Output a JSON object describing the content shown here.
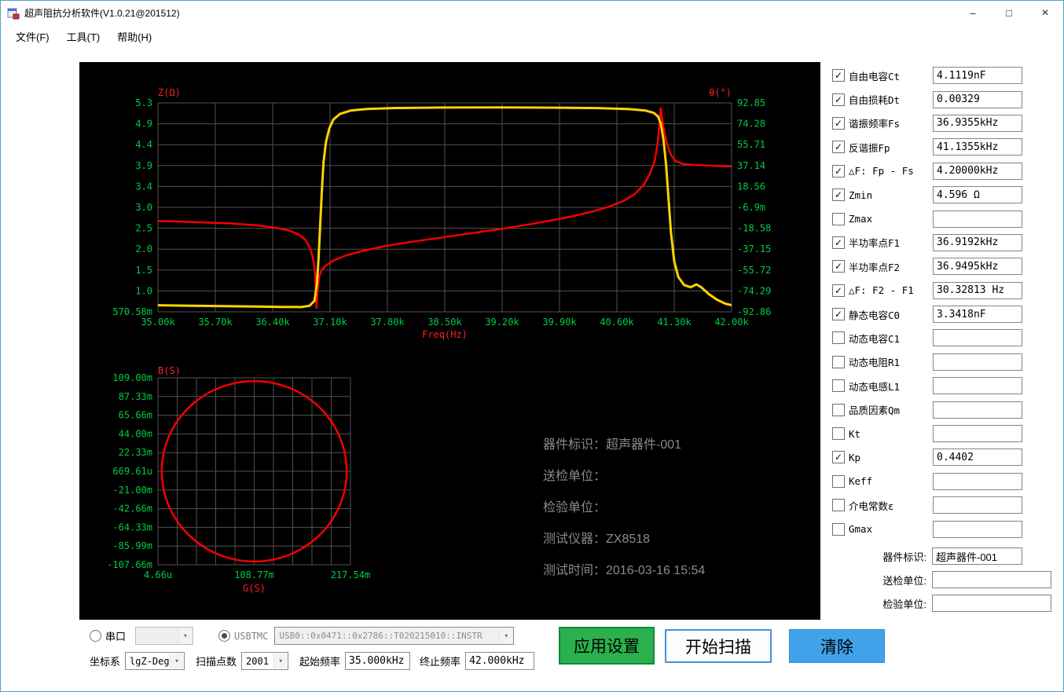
{
  "window": {
    "title": "超声阻抗分析软件(V1.0.21@201512)",
    "controls": {
      "minimize": "–",
      "maximize": "□",
      "close": "×"
    }
  },
  "menu": {
    "items": [
      "文件(F)",
      "工具(T)",
      "帮助(H)"
    ]
  },
  "colors": {
    "grid": "#525252",
    "tick": "#00cc44",
    "axis_label": "#ff2020",
    "curve_impedance": "#f40000",
    "curve_phase": "#ffd400",
    "apply_button": "#2ab04d",
    "clear_button": "#41a2ea"
  },
  "chart_data": [
    {
      "type": "line",
      "title_left": "Z(Ω)",
      "title_right": "θ(°)",
      "xlabel": "Freq(Hz)",
      "x_ticks": [
        "35.00k",
        "35.70k",
        "36.40k",
        "37.10k",
        "37.80k",
        "38.50k",
        "39.20k",
        "39.90k",
        "40.60k",
        "41.30k",
        "42.00k"
      ],
      "y_left_ticks": [
        "5.3",
        "4.9",
        "4.4",
        "3.9",
        "3.4",
        "3.0",
        "2.5",
        "2.0",
        "1.5",
        "1.0",
        "570.58m"
      ],
      "y_right_ticks": [
        "92.85",
        "74.28",
        "55.71",
        "37.14",
        "18.56",
        "-6.9m",
        "-18.58",
        "-37.15",
        "-55.72",
        "-74.29",
        "-92.86"
      ],
      "x_range": [
        35.0,
        42.0
      ],
      "y_left_range": [
        0.5706,
        5.3
      ],
      "y_right_range": [
        -92.86,
        92.85
      ],
      "grid": true,
      "series": [
        {
          "name": "impedance",
          "color": "#f40000",
          "axis": "left",
          "points": [
            [
              35.0,
              2.63
            ],
            [
              35.3,
              2.61
            ],
            [
              35.6,
              2.59
            ],
            [
              35.9,
              2.57
            ],
            [
              36.2,
              2.53
            ],
            [
              36.45,
              2.47
            ],
            [
              36.6,
              2.41
            ],
            [
              36.72,
              2.32
            ],
            [
              36.8,
              2.2
            ],
            [
              36.86,
              2.0
            ],
            [
              36.9,
              1.72
            ],
            [
              36.92,
              1.38
            ],
            [
              36.9355,
              0.66
            ],
            [
              36.95,
              1.1
            ],
            [
              36.97,
              1.38
            ],
            [
              37.0,
              1.52
            ],
            [
              37.05,
              1.62
            ],
            [
              37.15,
              1.74
            ],
            [
              37.3,
              1.85
            ],
            [
              37.5,
              1.95
            ],
            [
              37.75,
              2.05
            ],
            [
              38.0,
              2.13
            ],
            [
              38.3,
              2.21
            ],
            [
              38.6,
              2.29
            ],
            [
              38.9,
              2.37
            ],
            [
              39.2,
              2.45
            ],
            [
              39.5,
              2.54
            ],
            [
              39.8,
              2.64
            ],
            [
              40.05,
              2.73
            ],
            [
              40.3,
              2.84
            ],
            [
              40.5,
              2.95
            ],
            [
              40.68,
              3.08
            ],
            [
              40.82,
              3.24
            ],
            [
              40.93,
              3.45
            ],
            [
              41.0,
              3.68
            ],
            [
              41.06,
              3.98
            ],
            [
              41.1,
              4.4
            ],
            [
              41.1355,
              5.18
            ],
            [
              41.17,
              4.75
            ],
            [
              41.21,
              4.38
            ],
            [
              41.26,
              4.12
            ],
            [
              41.32,
              3.98
            ],
            [
              41.4,
              3.92
            ],
            [
              41.5,
              3.9
            ],
            [
              41.6,
              3.89
            ],
            [
              41.75,
              3.88
            ],
            [
              42.0,
              3.86
            ]
          ]
        },
        {
          "name": "phase",
          "color": "#ffd400",
          "axis": "right",
          "points": [
            [
              35.0,
              -87.0
            ],
            [
              35.4,
              -87.4
            ],
            [
              35.8,
              -87.8
            ],
            [
              36.2,
              -88.2
            ],
            [
              36.5,
              -88.5
            ],
            [
              36.75,
              -88.6
            ],
            [
              36.85,
              -87.5
            ],
            [
              36.91,
              -83
            ],
            [
              36.94,
              -68
            ],
            [
              36.96,
              -45
            ],
            [
              36.98,
              -15
            ],
            [
              37.0,
              15
            ],
            [
              37.02,
              40
            ],
            [
              37.05,
              58
            ],
            [
              37.09,
              70
            ],
            [
              37.14,
              78
            ],
            [
              37.22,
              83
            ],
            [
              37.35,
              86
            ],
            [
              37.55,
              87.5
            ],
            [
              37.9,
              88.3
            ],
            [
              38.5,
              88.7
            ],
            [
              39.2,
              88.8
            ],
            [
              39.9,
              88.6
            ],
            [
              40.4,
              88.2
            ],
            [
              40.75,
              87.3
            ],
            [
              40.95,
              86
            ],
            [
              41.05,
              84
            ],
            [
              41.1,
              81
            ],
            [
              41.1355,
              75
            ],
            [
              41.17,
              60
            ],
            [
              41.2,
              38
            ],
            [
              41.23,
              8
            ],
            [
              41.26,
              -22
            ],
            [
              41.3,
              -48
            ],
            [
              41.35,
              -62
            ],
            [
              41.42,
              -69
            ],
            [
              41.5,
              -71
            ],
            [
              41.57,
              -68.5
            ],
            [
              41.63,
              -71
            ],
            [
              41.72,
              -77
            ],
            [
              41.82,
              -82
            ],
            [
              41.92,
              -85.5
            ],
            [
              42.0,
              -87
            ]
          ]
        }
      ]
    },
    {
      "type": "line",
      "title": "B(S)",
      "xlabel": "G(S)",
      "x_ticks": [
        "4.66u",
        "108.77m",
        "217.54m"
      ],
      "y_ticks": [
        "109.00m",
        "87.33m",
        "65.66m",
        "44.00m",
        "22.33m",
        "669.61u",
        "-21.00m",
        "-42.66m",
        "-64.33m",
        "-85.99m",
        "-107.66m"
      ],
      "x_range": [
        4.66e-06,
        0.21754
      ],
      "y_range": [
        -0.10766,
        0.109
      ],
      "grid": true,
      "circle": {
        "cx": 0.10877,
        "cy": 0.00067,
        "r": 0.1045,
        "color": "#f40000"
      }
    }
  ],
  "info": {
    "lines": [
      "器件标识：超声器件-001",
      "送检单位：",
      "检验单位：",
      "测试仪器：ZX8518",
      "测试时间：2016-03-16 15:54"
    ]
  },
  "results": {
    "rows": [
      {
        "label": "自由电容Ct",
        "checked": true,
        "value": "4.1119nF"
      },
      {
        "label": "自由损耗Dt",
        "checked": true,
        "value": "0.00329"
      },
      {
        "label": "谐振频率Fs",
        "checked": true,
        "value": "36.9355kHz"
      },
      {
        "label": "反谐振Fp",
        "checked": true,
        "value": "41.1355kHz"
      },
      {
        "label": "△F: Fp - Fs",
        "checked": true,
        "value": "4.20000kHz"
      },
      {
        "label": "Zmin",
        "checked": true,
        "value": "4.596 Ω"
      },
      {
        "label": "Zmax",
        "checked": false,
        "value": ""
      },
      {
        "label": "半功率点F1",
        "checked": true,
        "value": "36.9192kHz"
      },
      {
        "label": "半功率点F2",
        "checked": true,
        "value": "36.9495kHz"
      },
      {
        "label": "△F: F2 - F1",
        "checked": true,
        "value": "30.32813 Hz"
      },
      {
        "label": "静态电容C0",
        "checked": true,
        "value": "3.3418nF"
      },
      {
        "label": "动态电容C1",
        "checked": false,
        "value": ""
      },
      {
        "label": "动态电阻R1",
        "checked": false,
        "value": ""
      },
      {
        "label": "动态电感L1",
        "checked": false,
        "value": ""
      },
      {
        "label": "品质因素Qm",
        "checked": false,
        "value": ""
      },
      {
        "label": "Kt",
        "checked": false,
        "value": ""
      },
      {
        "label": "Kp",
        "checked": true,
        "value": "0.4402"
      },
      {
        "label": "Keff",
        "checked": false,
        "value": ""
      },
      {
        "label": "介电常数ε",
        "checked": false,
        "value": ""
      },
      {
        "label": "Gmax",
        "checked": false,
        "value": ""
      }
    ]
  },
  "identity": {
    "rows": [
      {
        "label": "器件标识:",
        "value": "超声器件-001"
      },
      {
        "label": "送检单位:",
        "value": ""
      },
      {
        "label": "检验单位:",
        "value": ""
      }
    ]
  },
  "connection": {
    "serial_label": "串口",
    "serial_value": "",
    "serial_selected": false,
    "usbtmc_label": "USBTMC",
    "usbtmc_value": "USB0::0x0471::0x2786::T020215010::INSTR",
    "usbtmc_selected": true
  },
  "sweep": {
    "coord_label": "坐标系",
    "coord_value": "lgZ-Deg",
    "points_label": "扫描点数",
    "points_value": "2001",
    "start_label": "起始频率",
    "start_value": "35.000kHz",
    "stop_label": "终止频率",
    "stop_value": "42.000kHz"
  },
  "buttons": {
    "apply": "应用设置",
    "start": "开始扫描",
    "clear": "清除"
  }
}
